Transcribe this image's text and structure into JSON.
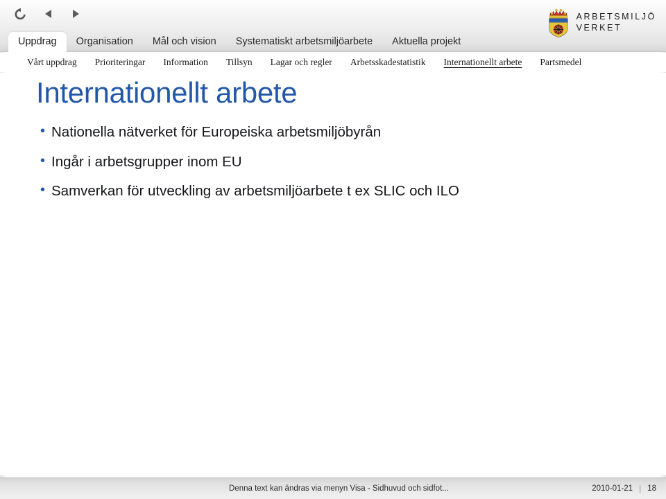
{
  "toolbar": {
    "buttons": [
      {
        "name": "reload-icon",
        "label": "Uppdatera"
      },
      {
        "name": "previous-arrow-icon",
        "label": "Föregående"
      },
      {
        "name": "next-arrow-icon",
        "label": "Nästa"
      }
    ]
  },
  "tabs": {
    "active": "Uppdrag",
    "items": [
      {
        "label": "Uppdrag",
        "active": true
      },
      {
        "label": "Organisation",
        "active": false
      },
      {
        "label": "Mål och vision",
        "active": false
      },
      {
        "label": "Systematiskt arbetsmiljöarbete",
        "active": false
      },
      {
        "label": "Aktuella projekt",
        "active": false
      }
    ]
  },
  "subnav": {
    "active": "Internationellt arbete",
    "items": [
      {
        "label": "Vårt uppdrag",
        "active": false
      },
      {
        "label": "Prioriteringar",
        "active": false
      },
      {
        "label": "Information",
        "active": false
      },
      {
        "label": "Tillsyn",
        "active": false
      },
      {
        "label": "Lagar och regler",
        "active": false
      },
      {
        "label": "Arbetsskadestatistik",
        "active": false
      },
      {
        "label": "Internationellt arbete",
        "active": true
      },
      {
        "label": "Partsmedel",
        "active": false
      }
    ]
  },
  "logo": {
    "crest_name": "swedish-coat-of-arms-crest-icon",
    "line1": "ARBETSMILJÖ",
    "line2": "VERKET"
  },
  "slide": {
    "title": "Internationellt arbete",
    "title_color": "#2358a8",
    "bullet_char": "•",
    "bullets": [
      "Nationella nätverket för Europeiska arbetsmiljöbyrån",
      "Ingår i arbetsgrupper inom EU",
      "Samverkan för utveckling av arbetsmiljöarbete t ex SLIC och ILO"
    ]
  },
  "footer": {
    "note": "Denna text kan ändras via menyn Visa - Sidhuvud och sidfot...",
    "date": "2010-01-21",
    "separator": "|",
    "page_number": "18"
  }
}
